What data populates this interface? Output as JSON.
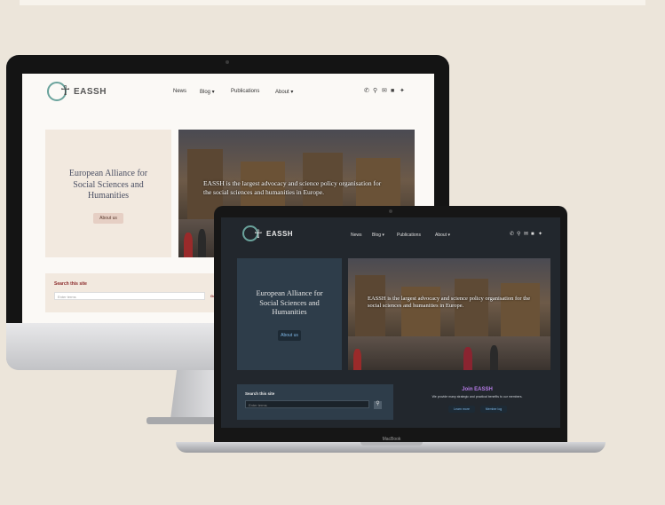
{
  "site": {
    "brand": "EASSH",
    "nav": [
      "News",
      "Blog ▾",
      "Publications",
      "About ▾"
    ],
    "hero_title": "European Alliance for Social Sciences and Humanities",
    "hero_button": "About us",
    "hero_text": "EASSH is the largest advocacy and science policy organisation for the social sciences and humanities in Europe.",
    "search_label": "Search this site",
    "search_placeholder": "Enter terms",
    "search_button": "Go",
    "join_title": "Join EASSH",
    "join_text": "We provide many strategic and practical benefits to our members.",
    "join_buttons": [
      "Learn more",
      "Member log"
    ],
    "icons": [
      "phone-icon",
      "search-icon",
      "email-icon",
      "linkedin-icon",
      "twitter-icon"
    ]
  },
  "device": {
    "laptop_label": "MacBook"
  },
  "colors": {
    "background": "#ece5da",
    "accent": "#6aa39c",
    "dark_bg": "#22272d",
    "dark_panel": "#2e3d4a",
    "join_purple": "#b57be6"
  }
}
